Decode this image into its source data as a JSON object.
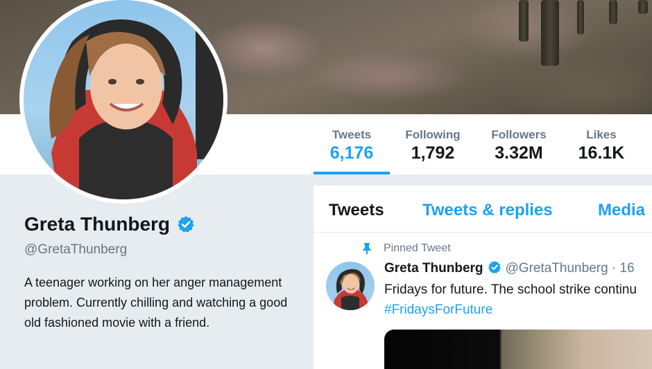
{
  "profile": {
    "name": "Greta Thunberg",
    "handle": "@GretaThunberg",
    "bio": "A teenager working on her anger management problem. Currently chilling and watching a good old fashioned movie with a friend."
  },
  "stats": [
    {
      "label": "Tweets",
      "value": "6,176",
      "active": true
    },
    {
      "label": "Following",
      "value": "1,792"
    },
    {
      "label": "Followers",
      "value": "3.32M"
    },
    {
      "label": "Likes",
      "value": "16.1K"
    }
  ],
  "tabs": [
    {
      "label": "Tweets",
      "active": true
    },
    {
      "label": "Tweets & replies"
    },
    {
      "label": "Media"
    }
  ],
  "pinned_tweet": {
    "pinned_label": "Pinned Tweet",
    "author_name": "Greta Thunberg",
    "author_handle": "@GretaThunberg · 16",
    "text": "Fridays for future. The school strike continu",
    "hashtag": "#FridaysForFuture"
  },
  "colors": {
    "accent": "#1da1f2",
    "text": "#14171a",
    "secondary": "#657786",
    "background": "#e6ecf0"
  },
  "icons": [
    "verified-badge-icon",
    "pin-icon"
  ]
}
